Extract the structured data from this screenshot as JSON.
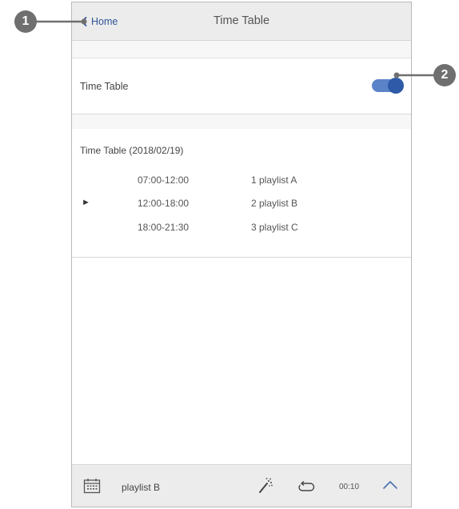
{
  "header": {
    "back_label": "Home",
    "title": "Time Table",
    "back_icon": "chevron-left-icon"
  },
  "time_table_toggle": {
    "label": "Time Table",
    "state": "on",
    "accent_color": "#2e5aa8"
  },
  "schedule": {
    "heading": "Time Table (2018/02/19)",
    "current_marker": "►",
    "entries": [
      {
        "time": "07:00-12:00",
        "playlist": "1 playlist A",
        "current": false
      },
      {
        "time": "12:00-18:00",
        "playlist": "2 playlist B",
        "current": true
      },
      {
        "time": "18:00-21:30",
        "playlist": "3 playlist C",
        "current": false
      }
    ]
  },
  "player_bar": {
    "playlist_name": "playlist B",
    "elapsed": "00:10",
    "icons": [
      "calendar-icon",
      "effects-wand-icon",
      "repeat-icon",
      "expand-up-icon"
    ]
  },
  "callouts": [
    {
      "number": "1",
      "target": "back-button"
    },
    {
      "number": "2",
      "target": "time-table-toggle"
    }
  ]
}
